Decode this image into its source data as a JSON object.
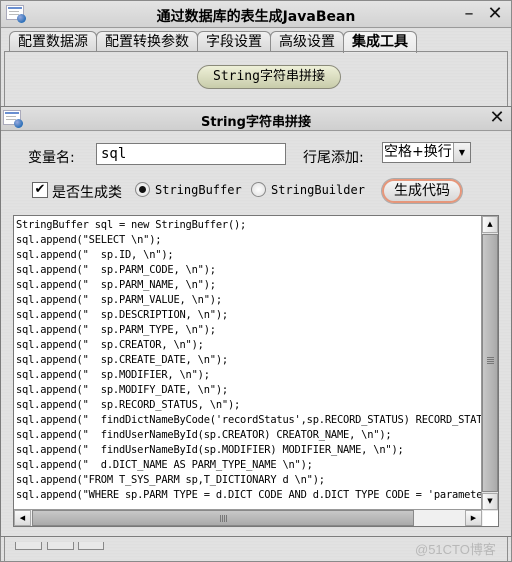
{
  "main_window": {
    "title": "通过数据库的表生成JavaBean",
    "minimize_label": "–",
    "close_label": "✕",
    "tabs": [
      {
        "label": "配置数据源"
      },
      {
        "label": "配置转换参数"
      },
      {
        "label": "字段设置"
      },
      {
        "label": "高级设置"
      },
      {
        "label": "集成工具",
        "active": true
      }
    ],
    "tool_button": {
      "prefix": "String",
      "suffix": "字符串拼接"
    },
    "watermark": "@51CTO博客"
  },
  "dialog": {
    "title": "String字符串拼接",
    "close_label": "✕",
    "variable_label": "变量名:",
    "variable_value": "sql",
    "line_suffix_label": "行尾添加:",
    "line_suffix_value": "空格+换行",
    "generate_class_label": "是否生成类",
    "generate_class_checked": true,
    "radio_options": [
      {
        "label": "StringBuffer",
        "selected": true
      },
      {
        "label": "StringBuilder",
        "selected": false
      }
    ],
    "generate_button_label": "生成代码",
    "code_lines": [
      "StringBuffer sql = new StringBuffer();",
      "sql.append(\"SELECT \\n\");",
      "sql.append(\"  sp.ID, \\n\");",
      "sql.append(\"  sp.PARM_CODE, \\n\");",
      "sql.append(\"  sp.PARM_NAME, \\n\");",
      "sql.append(\"  sp.PARM_VALUE, \\n\");",
      "sql.append(\"  sp.DESCRIPTION, \\n\");",
      "sql.append(\"  sp.PARM_TYPE, \\n\");",
      "sql.append(\"  sp.CREATOR, \\n\");",
      "sql.append(\"  sp.CREATE_DATE, \\n\");",
      "sql.append(\"  sp.MODIFIER, \\n\");",
      "sql.append(\"  sp.MODIFY_DATE, \\n\");",
      "sql.append(\"  sp.RECORD_STATUS, \\n\");",
      "sql.append(\"  findDictNameByCode('recordStatus',sp.RECORD_STATUS) RECORD_STATU",
      "sql.append(\"  findUserNameById(sp.CREATOR) CREATOR_NAME, \\n\");",
      "sql.append(\"  findUserNameById(sp.MODIFIER) MODIFIER_NAME, \\n\");",
      "sql.append(\"  d.DICT_NAME AS PARM_TYPE_NAME \\n\");",
      "sql.append(\"FROM T_SYS_PARM sp,T_DICTIONARY d \\n\");",
      "sql.append(\"WHERE sp.PARM_TYPE = d.DICT_CODE AND d.DICT_TYPE_CODE = 'parameter"
    ]
  }
}
